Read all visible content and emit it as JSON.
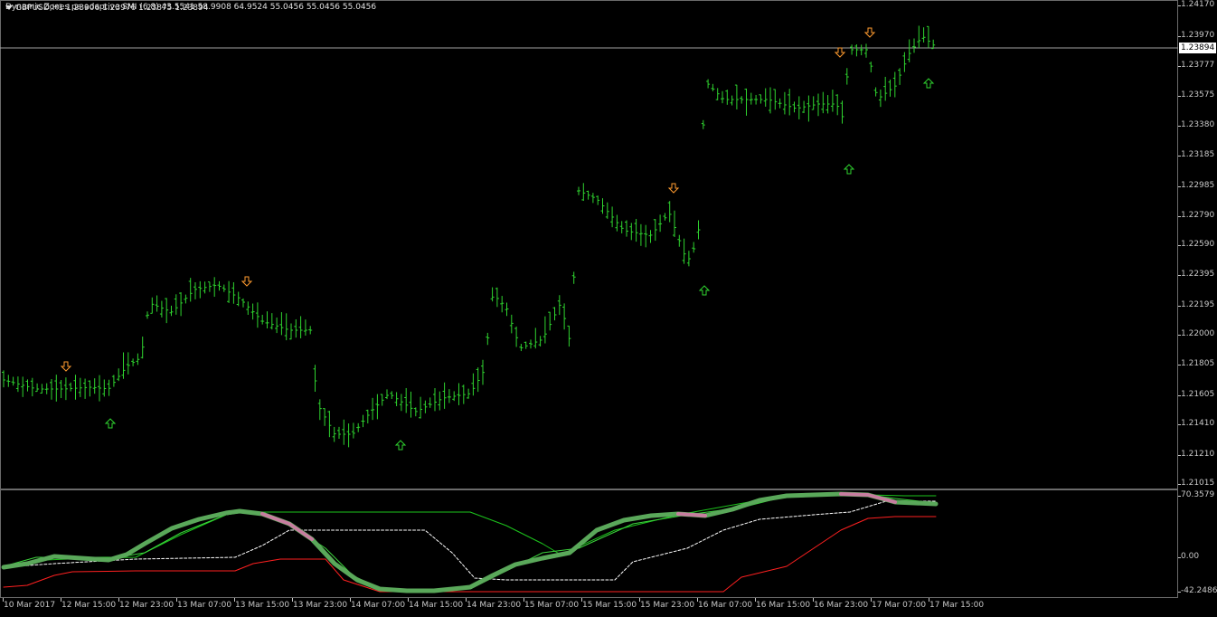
{
  "main": {
    "title_triangle": "menu-triangle-icon",
    "title": "GBPUSD,H1  1.23906 1.23976 1.23875 1.23894",
    "current_price": "1.23894",
    "price_labels": [
      "1.24170",
      "1.23970",
      "1.23777",
      "1.23575",
      "1.23380",
      "1.23185",
      "1.22985",
      "1.22790",
      "1.22590",
      "1.22395",
      "1.22195",
      "1.22000",
      "1.21805",
      "1.21605",
      "1.21410",
      "1.21210",
      "1.21015"
    ],
    "colors": {
      "bars": "#2fd42f",
      "arrow_up": "#2fd42f",
      "arrow_down": "#ff9b2f",
      "grid": "#6b6b6b",
      "bid_line": "#a0a0a0"
    },
    "arrow_icons": {
      "up": "up-arrow-icon",
      "down": "down-arrow-icon"
    }
  },
  "indicator": {
    "title": "Dynamic Zones pa adaptive SMI (6,8) 43.5541 58.9908 64.9524 55.0456 55.0456 55.0456",
    "labels": [
      "70.3579",
      "0.00",
      "-42.2486"
    ],
    "colors": {
      "smi_up": "#5aa85a",
      "smi_down": "#c77d9f",
      "signal": "#3cd23c",
      "upper_zone": "#1cc41c",
      "middle_zone": "#ffffff",
      "lower_zone": "#ff2020"
    }
  },
  "time_axis": {
    "labels": [
      "10 Mar 2017",
      "12 Mar 15:00",
      "12 Mar 23:00",
      "13 Mar 07:00",
      "13 Mar 15:00",
      "13 Mar 23:00",
      "14 Mar 07:00",
      "14 Mar 15:00",
      "14 Mar 23:00",
      "15 Mar 07:00",
      "15 Mar 15:00",
      "15 Mar 23:00",
      "16 Mar 07:00",
      "16 Mar 15:00",
      "16 Mar 23:00",
      "17 Mar 07:00",
      "17 Mar 15:00"
    ]
  }
}
